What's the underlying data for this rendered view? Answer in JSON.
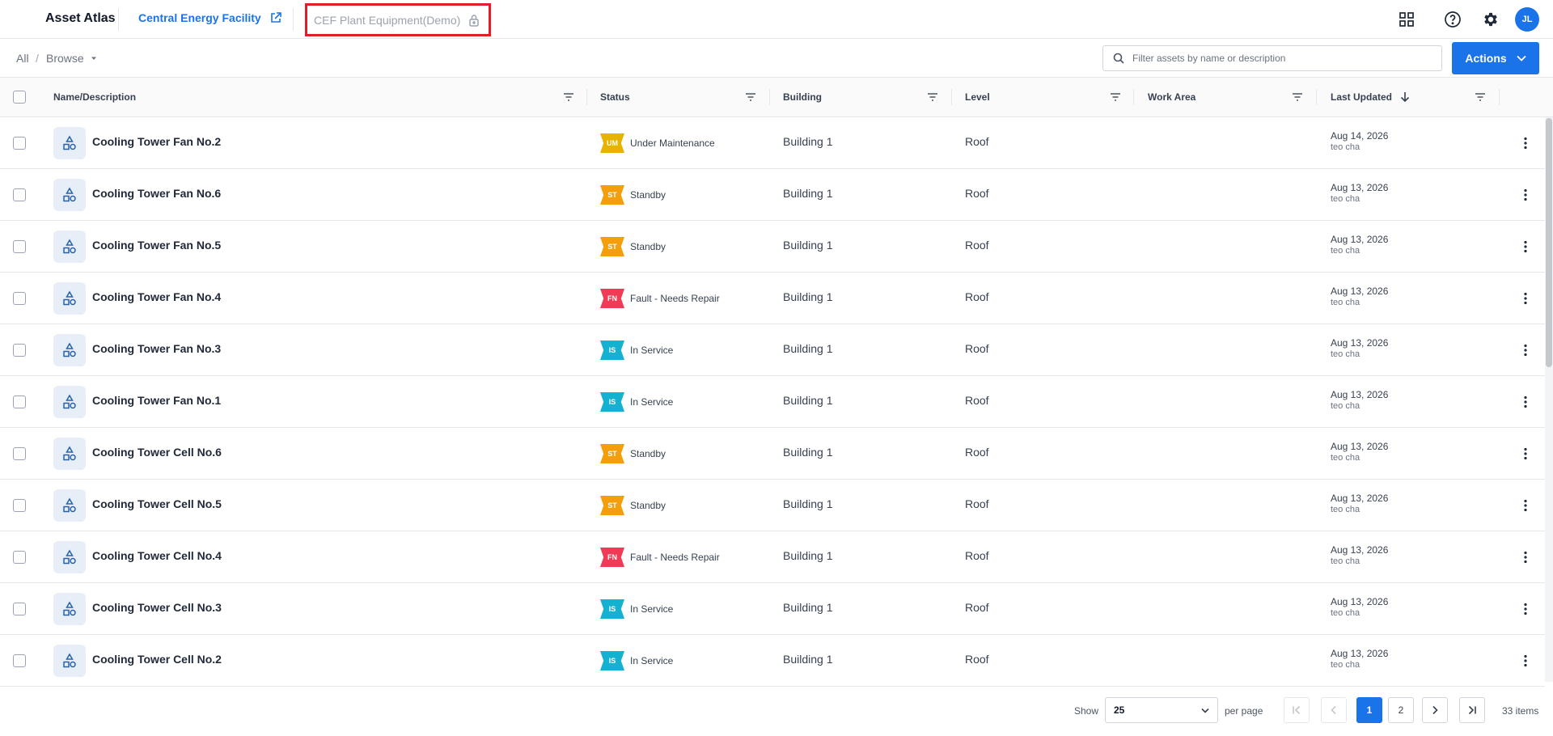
{
  "app": {
    "name": "Asset Atlas",
    "site": "Central Energy Facility",
    "project": "CEF Plant Equipment(Demo)",
    "user_initials": "JL",
    "accent": "#1a73e8"
  },
  "breadcrumb": {
    "root": "All",
    "separator": "/",
    "current": "Browse"
  },
  "search": {
    "placeholder": "Filter assets by name or description"
  },
  "actions": {
    "label": "Actions"
  },
  "columns": [
    "Name/Description",
    "Status",
    "Building",
    "Level",
    "Work Area",
    "Last Updated"
  ],
  "status_colors": {
    "UM": "#e5b300",
    "ST": "#f59e0b",
    "FN": "#ef3b55",
    "IS": "#14b1d0"
  },
  "rows": [
    {
      "name": "Cooling Tower Fan No.2",
      "code": "UM",
      "status": "Under Maintenance",
      "building": "Building 1",
      "level": "Roof",
      "work_area": "",
      "date": "Aug 14, 2026",
      "user": "teo cha"
    },
    {
      "name": "Cooling Tower Fan No.6",
      "code": "ST",
      "status": "Standby",
      "building": "Building 1",
      "level": "Roof",
      "work_area": "",
      "date": "Aug 13, 2026",
      "user": "teo cha"
    },
    {
      "name": "Cooling Tower Fan No.5",
      "code": "ST",
      "status": "Standby",
      "building": "Building 1",
      "level": "Roof",
      "work_area": "",
      "date": "Aug 13, 2026",
      "user": "teo cha"
    },
    {
      "name": "Cooling Tower Fan No.4",
      "code": "FN",
      "status": "Fault - Needs Repair",
      "building": "Building 1",
      "level": "Roof",
      "work_area": "",
      "date": "Aug 13, 2026",
      "user": "teo cha"
    },
    {
      "name": "Cooling Tower Fan No.3",
      "code": "IS",
      "status": "In Service",
      "building": "Building 1",
      "level": "Roof",
      "work_area": "",
      "date": "Aug 13, 2026",
      "user": "teo cha"
    },
    {
      "name": "Cooling Tower Fan No.1",
      "code": "IS",
      "status": "In Service",
      "building": "Building 1",
      "level": "Roof",
      "work_area": "",
      "date": "Aug 13, 2026",
      "user": "teo cha"
    },
    {
      "name": "Cooling Tower Cell No.6",
      "code": "ST",
      "status": "Standby",
      "building": "Building 1",
      "level": "Roof",
      "work_area": "",
      "date": "Aug 13, 2026",
      "user": "teo cha"
    },
    {
      "name": "Cooling Tower Cell No.5",
      "code": "ST",
      "status": "Standby",
      "building": "Building 1",
      "level": "Roof",
      "work_area": "",
      "date": "Aug 13, 2026",
      "user": "teo cha"
    },
    {
      "name": "Cooling Tower Cell No.4",
      "code": "FN",
      "status": "Fault - Needs Repair",
      "building": "Building 1",
      "level": "Roof",
      "work_area": "",
      "date": "Aug 13, 2026",
      "user": "teo cha"
    },
    {
      "name": "Cooling Tower Cell No.3",
      "code": "IS",
      "status": "In Service",
      "building": "Building 1",
      "level": "Roof",
      "work_area": "",
      "date": "Aug 13, 2026",
      "user": "teo cha"
    },
    {
      "name": "Cooling Tower Cell No.2",
      "code": "IS",
      "status": "In Service",
      "building": "Building 1",
      "level": "Roof",
      "work_area": "",
      "date": "Aug 13, 2026",
      "user": "teo cha"
    }
  ],
  "pagination": {
    "show_label": "Show",
    "per_page_value": "25",
    "per_page_label": "per page",
    "pages": [
      "1",
      "2"
    ],
    "current_page": "1",
    "total": "33 items"
  }
}
